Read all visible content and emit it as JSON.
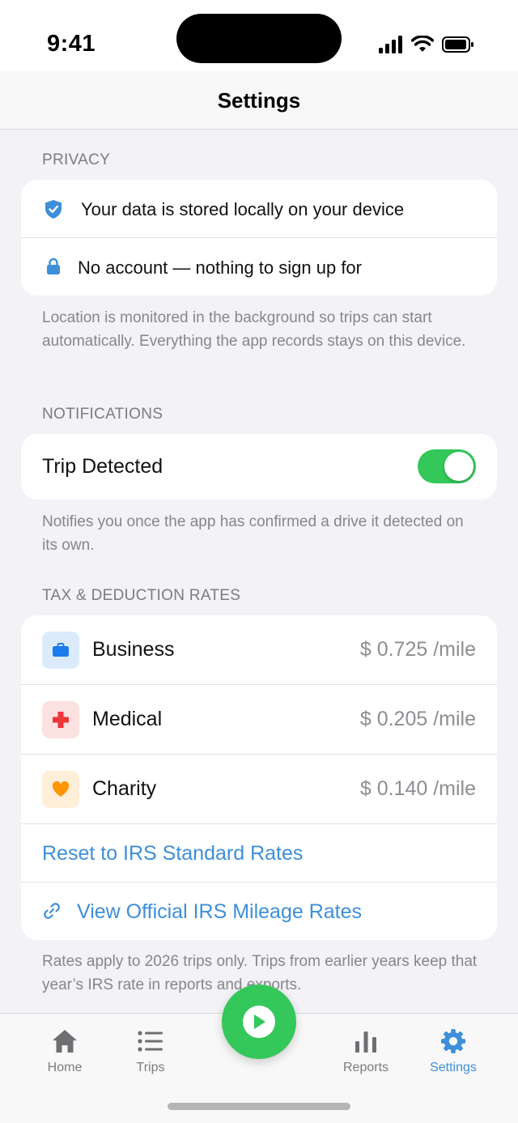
{
  "status_bar": {
    "time": "9:41"
  },
  "nav": {
    "title": "Settings"
  },
  "privacy": {
    "header": "PRIVACY",
    "items": [
      {
        "icon": "shield-check-icon",
        "label": "Your data is stored locally on your device"
      },
      {
        "icon": "lock-icon",
        "label": "No account — nothing to sign up for"
      }
    ],
    "footer": "Location is monitored in the background so trips can start automatically. Everything the app records stays on this device."
  },
  "notifications": {
    "header": "NOTIFICATIONS",
    "trip_detected": {
      "label": "Trip Detected",
      "enabled": true
    },
    "footer": "Notifies you once the app has confirmed a drive it detected on its own."
  },
  "rates": {
    "header": "TAX & DEDUCTION RATES",
    "items": [
      {
        "label": "Business",
        "value": "$ 0.725 /mile",
        "icon": "briefcase-icon",
        "color": "#1A7BEA",
        "bg": "#DCEBFB"
      },
      {
        "label": "Medical",
        "value": "$ 0.205 /mile",
        "icon": "medical-cross-icon",
        "color": "#F0363A",
        "bg": "#FCE1E1"
      },
      {
        "label": "Charity",
        "value": "$ 0.140 /mile",
        "icon": "heart-icon",
        "color": "#FF9500",
        "bg": "#FFEFD9"
      }
    ],
    "reset_label": "Reset to IRS Standard Rates",
    "view_label": "View Official IRS Mileage Rates",
    "footer": "Rates apply to 2026 trips only. Trips from earlier years keep that year’s IRS rate in reports and exports."
  },
  "tabs": [
    {
      "label": "Home",
      "icon": "house-icon",
      "active": false
    },
    {
      "label": "Trips",
      "icon": "list-icon",
      "active": false
    },
    {
      "label": "Reports",
      "icon": "bar-chart-icon",
      "active": false
    },
    {
      "label": "Settings",
      "icon": "gear-icon",
      "active": true
    }
  ],
  "colors": {
    "accent": "#3D8FD9",
    "green": "#34C759"
  }
}
